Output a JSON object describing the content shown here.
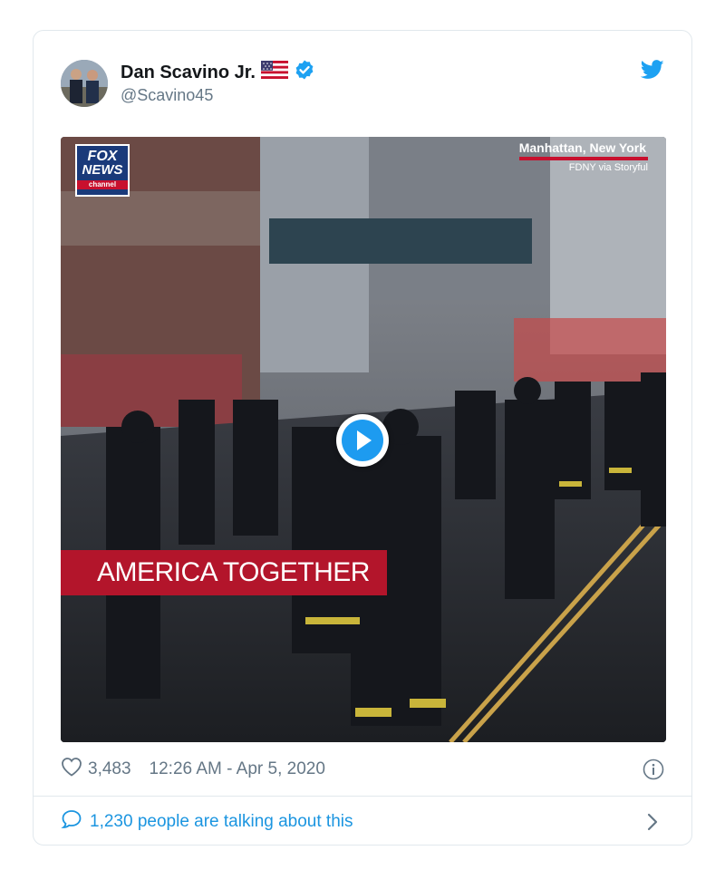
{
  "tweet": {
    "author": {
      "name": "Dan Scavino Jr.",
      "handle": "@Scavino45",
      "flag_icon": "us-flag-icon",
      "verified_icon": "verified-badge-icon"
    },
    "media": {
      "channel_logo": {
        "line1": "FOX",
        "line2": "NEWS",
        "line3": "channel"
      },
      "location": "Manhattan, New York",
      "source": "FDNY via Storyful",
      "banner": "AMERICA TOGETHER",
      "play_icon": "play-icon"
    },
    "likes": "3,483",
    "timestamp": "12:26 AM - Apr 5, 2020",
    "talking": "1,230 people are talking about this",
    "colors": {
      "accent": "#1da1f2",
      "banner_red": "#b3152b",
      "muted": "#657786"
    }
  }
}
